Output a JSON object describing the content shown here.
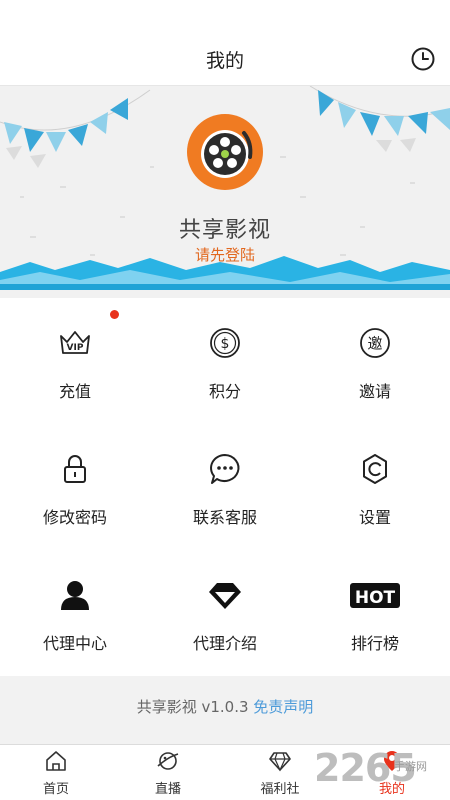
{
  "header": {
    "title": "我的",
    "history_icon": "clock-icon"
  },
  "banner": {
    "app_name": "共享影视",
    "login_prompt": "请先登陆",
    "accent": "#e2681f",
    "wave_color": "#2ab3e4"
  },
  "menu": {
    "items": [
      {
        "label": "充值",
        "icon": "vip-crown-icon",
        "badge": true
      },
      {
        "label": "积分",
        "icon": "dollar-coin-icon"
      },
      {
        "label": "邀请",
        "icon": "invite-icon"
      },
      {
        "label": "修改密码",
        "icon": "lock-icon"
      },
      {
        "label": "联系客服",
        "icon": "chat-bubble-icon"
      },
      {
        "label": "设置",
        "icon": "gear-icon"
      },
      {
        "label": "代理中心",
        "icon": "person-icon"
      },
      {
        "label": "代理介绍",
        "icon": "diamond-icon"
      },
      {
        "label": "排行榜",
        "icon": "hot-badge-icon"
      }
    ],
    "vip_text": "VIP",
    "invite_char": "邀",
    "hot_text": "HOT"
  },
  "footer": {
    "version_text": "共享影视 v1.0.3",
    "disclaimer": "免责声明",
    "link_color": "#4d9bd9"
  },
  "tabbar": {
    "items": [
      {
        "label": "首页",
        "icon": "home-icon"
      },
      {
        "label": "直播",
        "icon": "live-planet-icon"
      },
      {
        "label": "福利社",
        "icon": "gem-icon"
      },
      {
        "label": "我的",
        "icon": "profile-pin-icon",
        "active": true
      }
    ],
    "active_color": "#e8321c"
  },
  "watermark": {
    "number": "2265",
    "site": "手游网"
  }
}
